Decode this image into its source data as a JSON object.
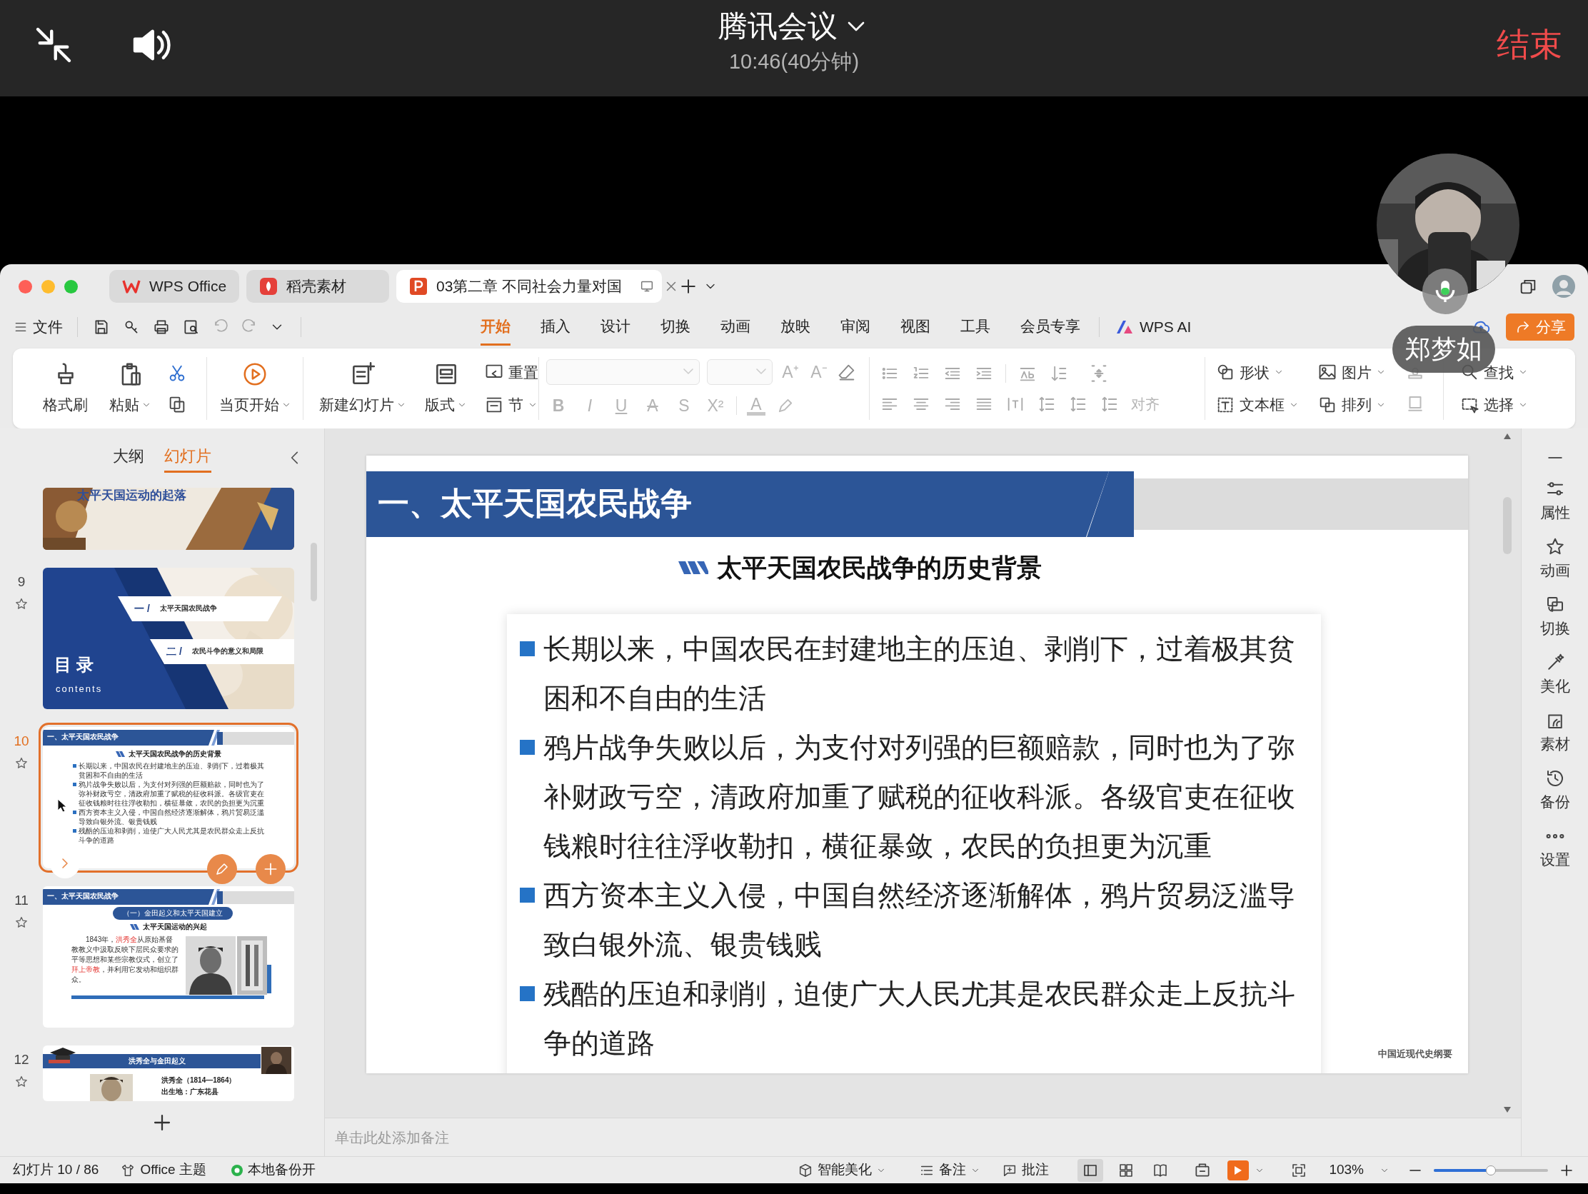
{
  "meeting": {
    "title": "腾讯会议",
    "time": "10:46(40分钟)",
    "end": "结束"
  },
  "participant": {
    "name": "郑梦如",
    "mic_on": true
  },
  "tabs": [
    {
      "kind": "wps",
      "label": "WPS Office",
      "selected": false
    },
    {
      "kind": "docer",
      "label": "稻壳素材",
      "selected": false
    },
    {
      "kind": "ppt",
      "label": "03第二章 不同社会力量对国",
      "selected": true
    }
  ],
  "menu": {
    "file": "文件",
    "tabs": [
      {
        "label": "开始",
        "selected": true
      },
      {
        "label": "插入",
        "selected": false
      },
      {
        "label": "设计",
        "selected": false
      },
      {
        "label": "切换",
        "selected": false
      },
      {
        "label": "动画",
        "selected": false
      },
      {
        "label": "放映",
        "selected": false
      },
      {
        "label": "审阅",
        "selected": false
      },
      {
        "label": "视图",
        "selected": false
      },
      {
        "label": "工具",
        "selected": false
      },
      {
        "label": "会员专享",
        "selected": false
      }
    ],
    "ai": "WPS AI",
    "share": "分享"
  },
  "ribbon": {
    "large": [
      {
        "label": "格式刷",
        "dropdown": false
      },
      {
        "label": "粘贴",
        "dropdown": true
      },
      {
        "label": "当页开始",
        "dropdown": true
      },
      {
        "label": "新建幻灯片",
        "dropdown": true
      },
      {
        "label": "版式",
        "dropdown": true
      }
    ],
    "small": [
      {
        "label": "重置",
        "dropdown": false
      },
      {
        "label": "节",
        "dropdown": true
      }
    ],
    "font_disabled": true,
    "font_glyphs": [
      "A⁺",
      "A⁻",
      "B",
      "I",
      "U",
      "A",
      "S",
      "X²",
      "A"
    ],
    "align": {
      "label": "对齐",
      "disabled": true
    },
    "insert": [
      {
        "label": "形状"
      },
      {
        "label": "图片"
      },
      {
        "label": "文本框"
      },
      {
        "label": "排列"
      }
    ],
    "find": [
      {
        "label": "查找"
      },
      {
        "label": "选择"
      }
    ]
  },
  "panel": {
    "tabs": [
      {
        "label": "大纲",
        "selected": false
      },
      {
        "label": "幻灯片",
        "selected": true
      }
    ],
    "slides": [
      {
        "kind": "cover",
        "selected": false,
        "title": "太平天国运动的起落"
      },
      {
        "kind": "contents",
        "number": "9",
        "selected": false,
        "heading": "目 录",
        "subheading": "contents",
        "items": [
          {
            "index": "一 /",
            "label": "太平天国农民战争"
          },
          {
            "index": "二 /",
            "label": "农民斗争的意义和局限"
          }
        ]
      },
      {
        "kind": "bullets",
        "number": "10",
        "selected": true,
        "header": "一、太平天国农民战争",
        "subtitle": "太平天国农民战争的历史背景",
        "bullets": [
          "长期以来，中国农民在封建地主的压迫、剥削下，过着极其贫困和不自由的生活",
          "鸦片战争失败以后，为支付对列强的巨额赔款，同时也为了弥补财政亏空，清政府加重了赋税的征收科派。各级官吏在征收钱粮时往往浮收勒扣，横征暴敛，农民的负担更为沉重",
          "西方资本主义入侵，中国自然经济逐渐解体，鸦片贸易泛滥导致白银外流、银贵钱贱",
          "残酷的压迫和剥削，迫使广大人民尤其是农民群众走上反抗斗争的道路"
        ]
      },
      {
        "kind": "image_text",
        "number": "11",
        "selected": false,
        "header": "一、太平天国农民战争",
        "pill": "（一）金田起义和太平天国建立",
        "subtitle": "太平天国运动的兴起",
        "paragraph": [
          {
            "text": "1843年，",
            "highlight": false
          },
          {
            "text": "洪秀全",
            "highlight": true
          },
          {
            "text": "从原始基督教教义中汲取反映下层民众要求的平等思想和某些宗教仪式，创立了",
            "highlight": false
          },
          {
            "text": "拜上帝教",
            "highlight": true
          },
          {
            "text": "，并利用它发动和组织群众。",
            "highlight": false
          }
        ]
      },
      {
        "kind": "portrait",
        "number": "12",
        "selected": false,
        "banner": "洪秀全与金田起义",
        "lines": [
          "洪秀全（1814—1864）",
          "出生地：广东花县"
        ]
      }
    ]
  },
  "slide": {
    "header": "一、太平天国农民战争",
    "subtitle": "太平天国农民战争的历史背景",
    "bullets": [
      "长期以来，中国农民在封建地主的压迫、剥削下，过着极其贫困和不自由的生活",
      "鸦片战争失败以后，为支付对列强的巨额赔款，同时也为了弥补财政亏空，清政府加重了赋税的征收科派。各级官吏在征收钱粮时往往浮收勒扣，横征暴敛，农民的负担更为沉重",
      "西方资本主义入侵，中国自然经济逐渐解体，鸦片贸易泛滥导致白银外流、银贵钱贱",
      "残酷的压迫和剥削，迫使广大人民尤其是农民群众走上反抗斗争的道路"
    ],
    "footer": "中国近现代史纲要"
  },
  "notes_placeholder": "单击此处添加备注",
  "sidebar": [
    "属性",
    "动画",
    "切换",
    "美化",
    "素材",
    "备份",
    "设置"
  ],
  "status": {
    "slide": "幻灯片 10 / 86",
    "theme": "Office 主题",
    "backup": "本地备份开",
    "beautify": "智能美化",
    "notes": "备注",
    "comments": "批注",
    "zoom": "103%",
    "zoom_slider": {
      "level": 0.5
    }
  }
}
